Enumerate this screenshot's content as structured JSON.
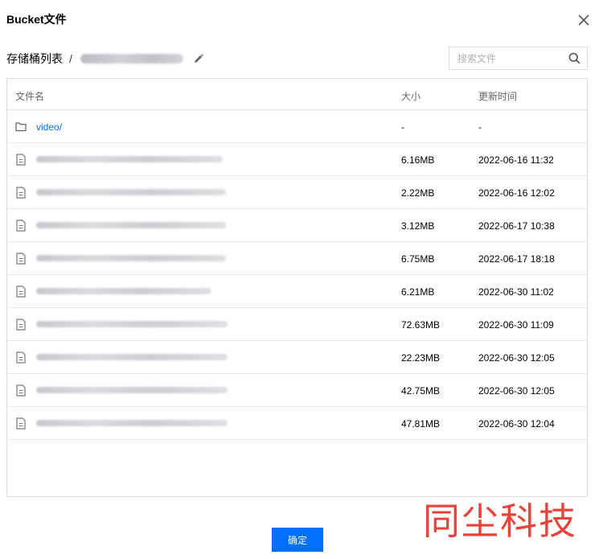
{
  "dialog": {
    "title": "Bucket文件"
  },
  "path": {
    "root": "存储桶列表",
    "separator": "/"
  },
  "search": {
    "placeholder": "搜索文件"
  },
  "table": {
    "headers": {
      "name": "文件名",
      "size": "大小",
      "time": "更新时间"
    },
    "rows": [
      {
        "type": "folder",
        "name": "video/",
        "size": "-",
        "time": "-"
      },
      {
        "type": "file",
        "size": "6.16MB",
        "time": "2022-06-16 11:32"
      },
      {
        "type": "file",
        "size": "2.22MB",
        "time": "2022-06-16 12:02"
      },
      {
        "type": "file",
        "size": "3.12MB",
        "time": "2022-06-17 10:38"
      },
      {
        "type": "file",
        "size": "6.75MB",
        "time": "2022-06-17 18:18"
      },
      {
        "type": "file",
        "size": "6.21MB",
        "time": "2022-06-30 11:02"
      },
      {
        "type": "file",
        "size": "72.63MB",
        "time": "2022-06-30 11:09"
      },
      {
        "type": "file",
        "size": "22.23MB",
        "time": "2022-06-30 12:05"
      },
      {
        "type": "file",
        "size": "42.75MB",
        "time": "2022-06-30 12:05"
      },
      {
        "type": "file",
        "size": "47.81MB",
        "time": "2022-06-30 12:04"
      }
    ]
  },
  "footer": {
    "confirm_label": "确定"
  },
  "watermark": {
    "text": "同尘科技"
  },
  "colors": {
    "accent": "#006eff",
    "watermark": "#e8433a"
  }
}
